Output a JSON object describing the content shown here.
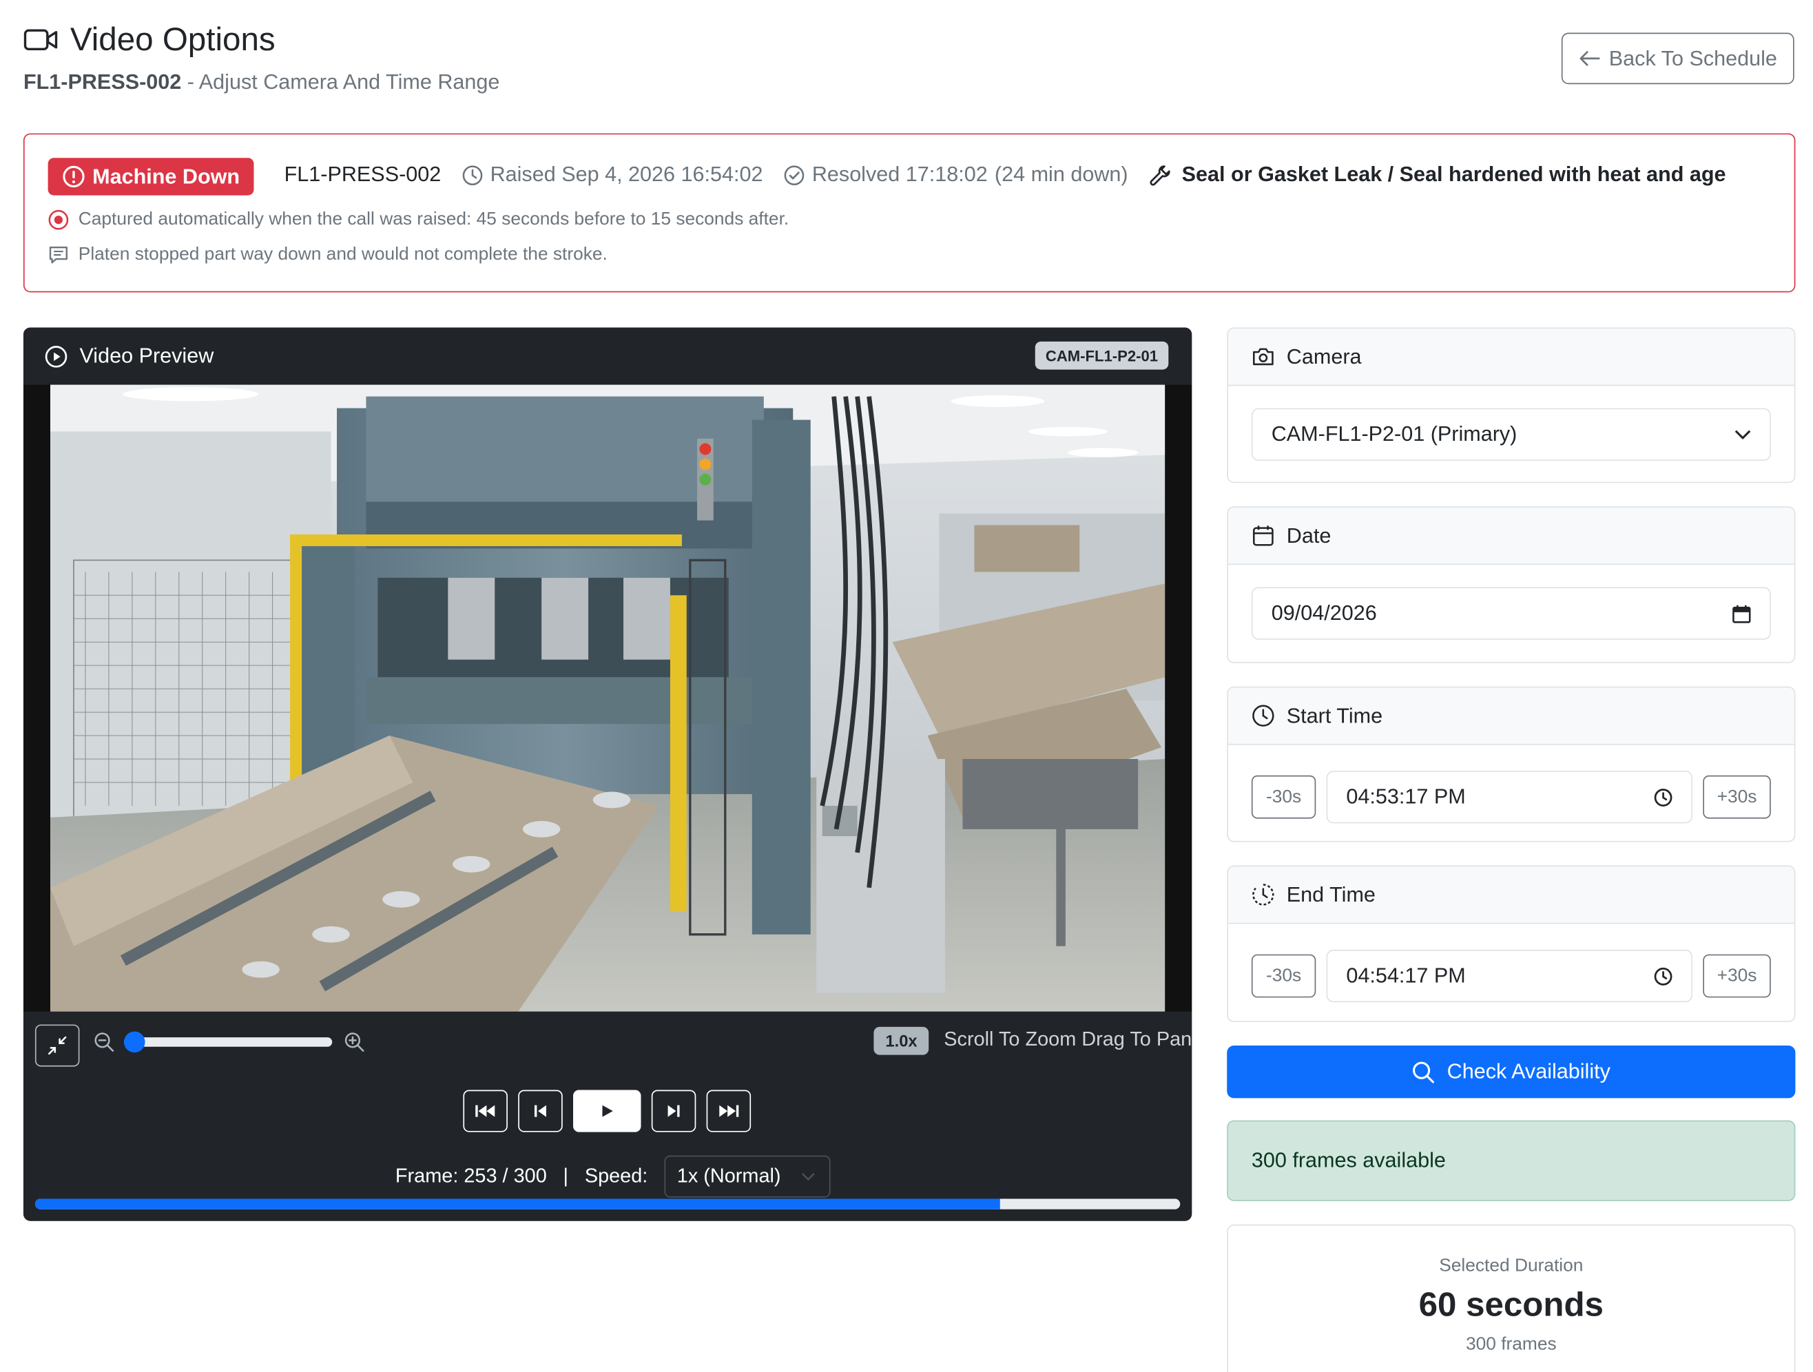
{
  "header": {
    "title": "Video Options",
    "subtitle_id": "FL1-PRESS-002",
    "subtitle_text": "- Adjust Camera And Time Range",
    "back_label": "Back To Schedule"
  },
  "alert": {
    "status_badge": "Machine Down",
    "machine": "FL1-PRESS-002",
    "raised": "Raised Sep 4, 2026 16:54:02",
    "resolved": "Resolved 17:18:02",
    "downtime": "(24 min down)",
    "issue": "Seal or Gasket Leak / Seal hardened with heat and age",
    "capture_note": "Captured automatically when the call was raised: 45 seconds before to 15 seconds after.",
    "comment": "Platen stopped part way down and would not complete the stroke.",
    "accent_color": "#dc3545"
  },
  "video": {
    "header_label": "Video Preview",
    "camera_badge": "CAM-FL1-P2-01",
    "zoom_level_label": "1.0x",
    "zoom_hint": "Scroll To Zoom Drag To Pan",
    "zoom_slider_fraction": 0.0,
    "frame_label": "Frame: 253 / 300",
    "speed_label": "Speed:",
    "speed_value": "1x (Normal)",
    "progress_fraction": 0.843,
    "controls": [
      "skip-start-icon",
      "step-back-icon",
      "play-icon",
      "step-forward-icon",
      "skip-end-icon"
    ]
  },
  "camera": {
    "label": "Camera",
    "selected": "CAM-FL1-P2-01 (Primary)"
  },
  "date": {
    "label": "Date",
    "value": "09/04/2026"
  },
  "start_time": {
    "label": "Start Time",
    "minus": "-30s",
    "value": "04:53:17 PM",
    "plus": "+30s"
  },
  "end_time": {
    "label": "End Time",
    "minus": "-30s",
    "value": "04:54:17 PM",
    "plus": "+30s"
  },
  "check_label": "Check Availability",
  "availability": "300 frames available",
  "duration": {
    "label": "Selected Duration",
    "value": "60 seconds",
    "frames": "300 frames"
  },
  "colors": {
    "primary": "#0d6efd",
    "danger": "#dc3545",
    "success_bg": "#d1e7dd",
    "dark": "#212529"
  }
}
